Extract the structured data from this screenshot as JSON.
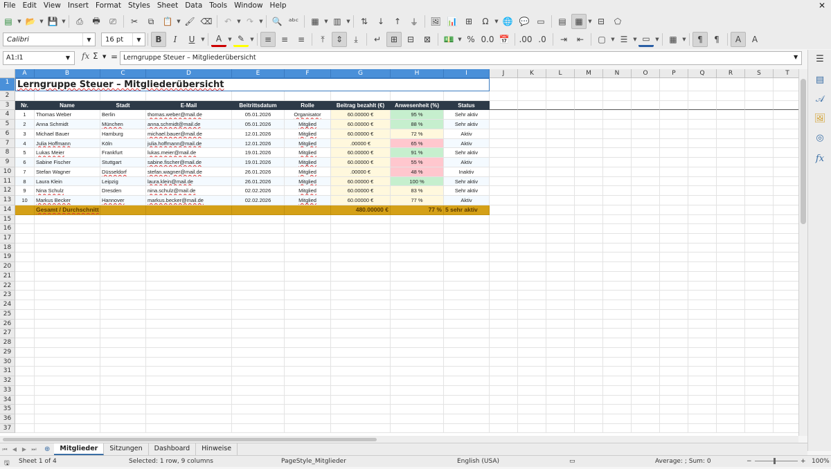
{
  "menu": [
    "File",
    "Edit",
    "View",
    "Insert",
    "Format",
    "Styles",
    "Sheet",
    "Data",
    "Tools",
    "Window",
    "Help"
  ],
  "font": {
    "name": "Calibri",
    "size": "16 pt"
  },
  "formula_bar": {
    "name_box": "A1:I1",
    "content": "Lerngruppe Steuer – Mitgliederübersicht"
  },
  "columns": [
    "A",
    "B",
    "C",
    "D",
    "E",
    "F",
    "G",
    "H",
    "I",
    "J",
    "K",
    "L",
    "M",
    "N",
    "O",
    "P",
    "Q",
    "R",
    "S",
    "T"
  ],
  "rows": [
    "1",
    "2",
    "3",
    "4",
    "5",
    "6",
    "7",
    "8",
    "9",
    "10",
    "11",
    "12",
    "13",
    "14",
    "15",
    "16",
    "17",
    "18",
    "19",
    "20",
    "21",
    "22",
    "23",
    "24",
    "25",
    "26",
    "27",
    "28",
    "29",
    "30",
    "31",
    "32",
    "33",
    "34",
    "35",
    "36",
    "37"
  ],
  "sheet": {
    "title": "Lerngruppe Steuer – Mitgliederübersicht",
    "headers": [
      "Nr.",
      "Name",
      "Stadt",
      "E-Mail",
      "Beitrittsdatum",
      "Rolle",
      "Beitrag bezahlt (€)",
      "Anwesenheit (%)",
      "Status"
    ],
    "data": [
      [
        "1",
        "Thomas Weber",
        "Berlin",
        "thomas.weber@mail.de",
        "05.01.2026",
        "Organisator",
        "60.00000 €",
        "95 %",
        "Sehr aktiv"
      ],
      [
        "2",
        "Anna Schmidt",
        "München",
        "anna.schmidt@mail.de",
        "05.01.2026",
        "Mitglied",
        "60.00000 €",
        "88 %",
        "Sehr aktiv"
      ],
      [
        "3",
        "Michael Bauer",
        "Hamburg",
        "michael.bauer@mail.de",
        "12.01.2026",
        "Mitglied",
        "60.00000 €",
        "72 %",
        "Aktiv"
      ],
      [
        "4",
        "Julia Hoffmann",
        "Köln",
        "julia.hoffmann@mail.de",
        "12.01.2026",
        "Mitglied",
        ".00000 €",
        "65 %",
        "Aktiv"
      ],
      [
        "5",
        "Lukas Meier",
        "Frankfurt",
        "lukas.meier@mail.de",
        "19.01.2026",
        "Mitglied",
        "60.00000 €",
        "91 %",
        "Sehr aktiv"
      ],
      [
        "6",
        "Sabine Fischer",
        "Stuttgart",
        "sabine.fischer@mail.de",
        "19.01.2026",
        "Mitglied",
        "60.00000 €",
        "55 %",
        "Aktiv"
      ],
      [
        "7",
        "Stefan Wagner",
        "Düsseldorf",
        "stefan.wagner@mail.de",
        "26.01.2026",
        "Mitglied",
        ".00000 €",
        "48 %",
        "Inaktiv"
      ],
      [
        "8",
        "Laura Klein",
        "Leipzig",
        "laura.klein@mail.de",
        "26.01.2026",
        "Mitglied",
        "60.00000 €",
        "100 %",
        "Sehr aktiv"
      ],
      [
        "9",
        "Nina Schulz",
        "Dresden",
        "nina.schulz@mail.de",
        "02.02.2026",
        "Mitglied",
        "60.00000 €",
        "83 %",
        "Sehr aktiv"
      ],
      [
        "10",
        "Markus Becker",
        "Hannover",
        "markus.becker@mail.de",
        "02.02.2026",
        "Mitglied",
        "60.00000 €",
        "77 %",
        "Aktiv"
      ]
    ],
    "totals": {
      "label": "Gesamt / Durchschnitt",
      "sum": "480.00000 €",
      "avg": "77 %",
      "active": "5 sehr aktiv"
    }
  },
  "tabs": [
    "Mitglieder",
    "Sitzungen",
    "Dashboard",
    "Hinweise"
  ],
  "status_bar": {
    "sheet": "Sheet 1 of 4",
    "selection": "Selected: 1 row, 9 columns",
    "page_style": "PageStyle_Mitglieder",
    "language": "English (USA)",
    "summary": "Average: ; Sum: 0",
    "zoom": "100%"
  }
}
